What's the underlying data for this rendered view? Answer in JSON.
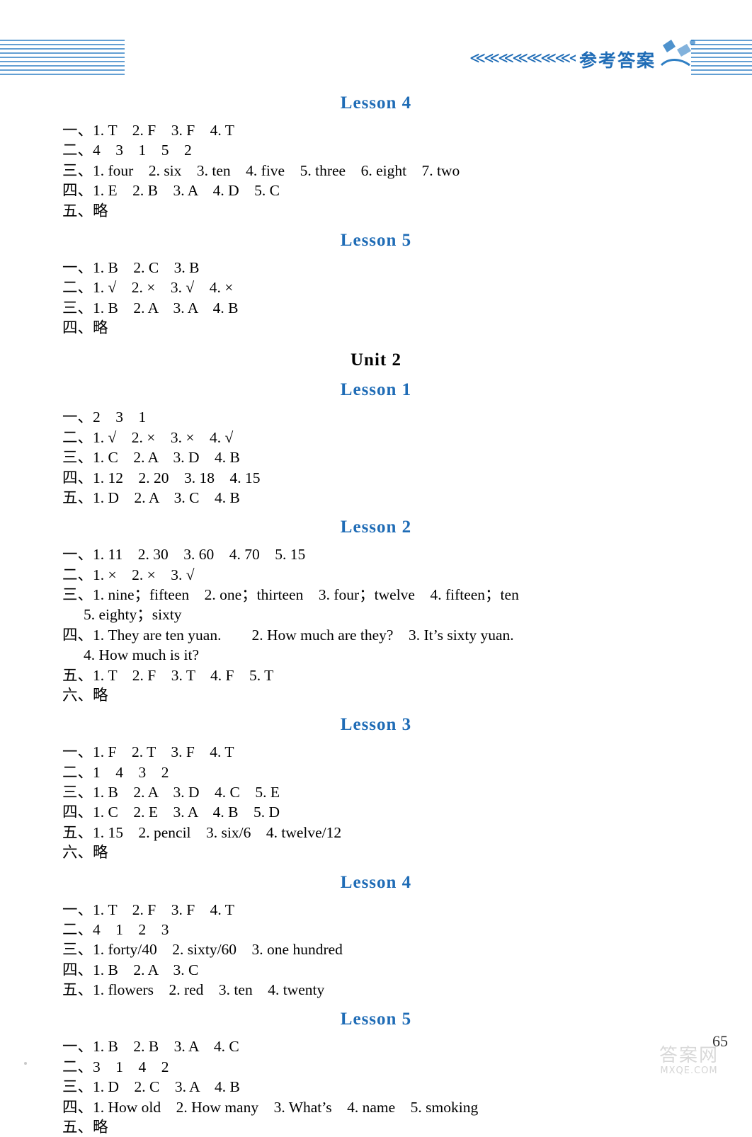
{
  "header": {
    "title": "参考答案",
    "chevrons": "≪≪≪≪≪≪≪≪≪≪≪≪≪"
  },
  "sections": [
    {
      "kind": "lesson",
      "heading": "Lesson 4",
      "lines": [
        {
          "text": "一、1. T　2. F　3. F　4. T",
          "indent": false
        },
        {
          "text": "二、4　3　1　5　2",
          "indent": false
        },
        {
          "text": "三、1. four　2. six　3. ten　4. five　5. three　6. eight　7. two",
          "indent": false
        },
        {
          "text": "四、1. E　2. B　3. A　4. D　5. C",
          "indent": false
        },
        {
          "text": "五、略",
          "indent": false
        }
      ]
    },
    {
      "kind": "lesson",
      "heading": "Lesson 5",
      "lines": [
        {
          "text": "一、1. B　2. C　3. B",
          "indent": false
        },
        {
          "text": "二、1. √　2. ×　3. √　4. ×",
          "indent": false
        },
        {
          "text": "三、1. B　2. A　3. A　4. B",
          "indent": false
        },
        {
          "text": "四、略",
          "indent": false
        }
      ]
    },
    {
      "kind": "unit",
      "heading": "Unit 2",
      "lines": []
    },
    {
      "kind": "lesson",
      "heading": "Lesson 1",
      "lines": [
        {
          "text": "一、2　3　1",
          "indent": false
        },
        {
          "text": "二、1. √　2. ×　3. ×　4. √",
          "indent": false
        },
        {
          "text": "三、1. C　2. A　3. D　4. B",
          "indent": false
        },
        {
          "text": "四、1. 12　2. 20　3. 18　4. 15",
          "indent": false
        },
        {
          "text": "五、1. D　2. A　3. C　4. B",
          "indent": false
        }
      ]
    },
    {
      "kind": "lesson",
      "heading": "Lesson 2",
      "lines": [
        {
          "text": "一、1. 11　2. 30　3. 60　4. 70　5. 15",
          "indent": false
        },
        {
          "text": "二、1. ×　2. ×　3. √",
          "indent": false
        },
        {
          "text": "三、1. nine；fifteen　2. one；thirteen　3. four；twelve　4. fifteen；ten",
          "indent": false
        },
        {
          "text": "5. eighty；sixty",
          "indent": true
        },
        {
          "text": "四、1. They are ten yuan.　　2. How much are they?　3. It’s sixty yuan.",
          "indent": false
        },
        {
          "text": "4. How much is it?",
          "indent": true
        },
        {
          "text": "五、1. T　2. F　3. T　4. F　5. T",
          "indent": false
        },
        {
          "text": "六、略",
          "indent": false
        }
      ]
    },
    {
      "kind": "lesson",
      "heading": "Lesson 3",
      "lines": [
        {
          "text": "一、1. F　2. T　3. F　4. T",
          "indent": false
        },
        {
          "text": "二、1　4　3　2",
          "indent": false
        },
        {
          "text": "三、1. B　2. A　3. D　4. C　5. E",
          "indent": false
        },
        {
          "text": "四、1. C　2. E　3. A　4. B　5. D",
          "indent": false
        },
        {
          "text": "五、1. 15　2. pencil　3. six/6　4. twelve/12",
          "indent": false
        },
        {
          "text": "六、略",
          "indent": false
        }
      ]
    },
    {
      "kind": "lesson",
      "heading": "Lesson 4",
      "lines": [
        {
          "text": "一、1. T　2. F　3. F　4. T",
          "indent": false
        },
        {
          "text": "二、4　1　2　3",
          "indent": false
        },
        {
          "text": "三、1. forty/40　2. sixty/60　3. one hundred",
          "indent": false
        },
        {
          "text": "四、1. B　2. A　3. C",
          "indent": false
        },
        {
          "text": "五、1. flowers　2. red　3. ten　4. twenty",
          "indent": false
        }
      ]
    },
    {
      "kind": "lesson",
      "heading": "Lesson 5",
      "lines": [
        {
          "text": "一、1. B　2. B　3. A　4. C",
          "indent": false
        },
        {
          "text": "二、3　1　4　2",
          "indent": false
        },
        {
          "text": "三、1. D　2. C　3. A　4. B",
          "indent": false
        },
        {
          "text": "四、1. How old　2. How many　3. What’s　4. name　5. smoking",
          "indent": false
        },
        {
          "text": "五、略",
          "indent": false
        }
      ]
    }
  ],
  "footer": {
    "page_number": "65",
    "watermark_cn": "答案网",
    "watermark_en": "MXQE.COM"
  },
  "colors": {
    "accent_blue": "#1f6cb6",
    "text_black": "#000000"
  }
}
